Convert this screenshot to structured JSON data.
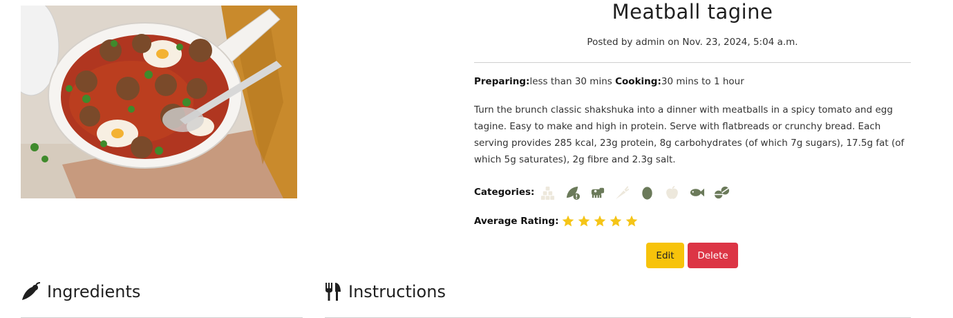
{
  "recipe": {
    "title": "Meatball tagine",
    "posted": "Posted by admin on Nov. 23, 2024, 5:04 a.m.",
    "preparing_label": "Preparing:",
    "preparing_value": "less than 30 mins",
    "cooking_label": "Cooking:",
    "cooking_value": "30 mins to 1 hour",
    "description": "Turn the brunch classic shakshuka into a dinner with meatballs in a spicy tomato and egg tagine. Easy to make and high in protein. Serve with flatbreads or crunchy bread. Each serving provides 285 kcal, 23g protein, 8g carbohydrates (of which 7g sugars), 17.5g fat (of which 5g saturates), 2g fibre and 2.3g salt.",
    "categories_label": "Categories:",
    "categories": [
      {
        "icon": "cubes-icon",
        "active": false
      },
      {
        "icon": "leaf-warning-icon",
        "active": true
      },
      {
        "icon": "cow-icon",
        "active": true
      },
      {
        "icon": "carrot-icon",
        "active": false
      },
      {
        "icon": "egg-icon",
        "active": true
      },
      {
        "icon": "apple-icon",
        "active": false
      },
      {
        "icon": "fish-icon",
        "active": true
      },
      {
        "icon": "pills-icon",
        "active": true
      }
    ],
    "rating_label": "Average Rating:",
    "rating": 5,
    "rating_max": 5
  },
  "actions": {
    "edit_label": "Edit",
    "delete_label": "Delete"
  },
  "sections": {
    "ingredients_title": "Ingredients",
    "instructions_title": "Instructions"
  },
  "colors": {
    "category_active": "#6b7a5a",
    "category_inactive": "#ede8dc",
    "star": "#f5c518",
    "edit_button": "#f7c30b",
    "delete_button": "#dc3545"
  }
}
